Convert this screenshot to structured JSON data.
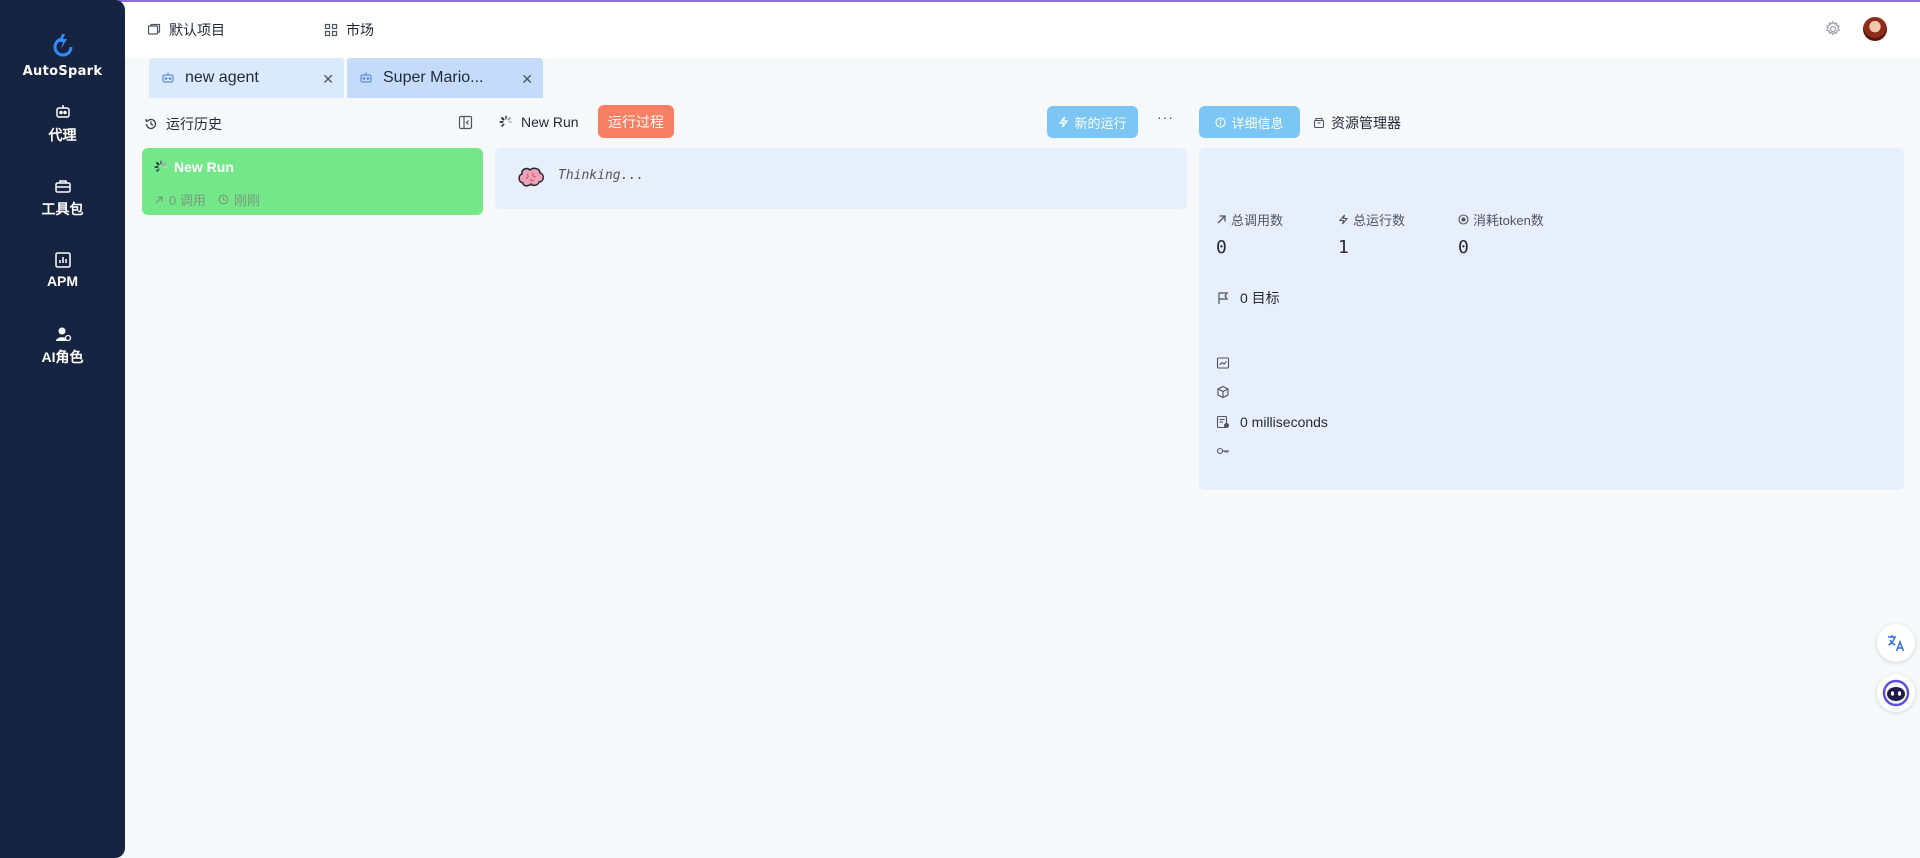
{
  "colors": {
    "sidebar_bg": "#172441",
    "accent_blue": "#7cc6f6",
    "process_orange": "#f77f63",
    "run_card_green": "#74e789",
    "panel_bg": "#e7effb"
  },
  "sidebar": {
    "brand": "AutoSpark",
    "items": [
      {
        "label": "代理",
        "icon": "robot-icon"
      },
      {
        "label": "工具包",
        "icon": "toolbox-icon"
      },
      {
        "label": "APM",
        "icon": "chart-icon"
      },
      {
        "label": "AI角色",
        "icon": "agent-persona-icon"
      }
    ]
  },
  "header": {
    "project": "默认项目",
    "market": "市场"
  },
  "tabs": [
    {
      "label": "new agent",
      "icon": "agent-icon"
    },
    {
      "label": "Super Mario...",
      "icon": "agent-icon"
    }
  ],
  "history": {
    "title": "运行历史",
    "runs": [
      {
        "name": "New Run",
        "calls": "0 调用",
        "time": "刚刚"
      }
    ]
  },
  "run_panel": {
    "title": "New Run",
    "process_button": "运行过程",
    "new_run_button": "新的运行",
    "more": "···",
    "thinking": "Thinking..."
  },
  "details": {
    "details_tab": "详细信息",
    "resources_tab": "资源管理器",
    "stats": [
      {
        "label": "总调用数",
        "value": "0"
      },
      {
        "label": "总运行数",
        "value": "1"
      },
      {
        "label": "消耗token数",
        "value": "0"
      }
    ],
    "goals": "0 目标",
    "duration": "0 milliseconds"
  }
}
